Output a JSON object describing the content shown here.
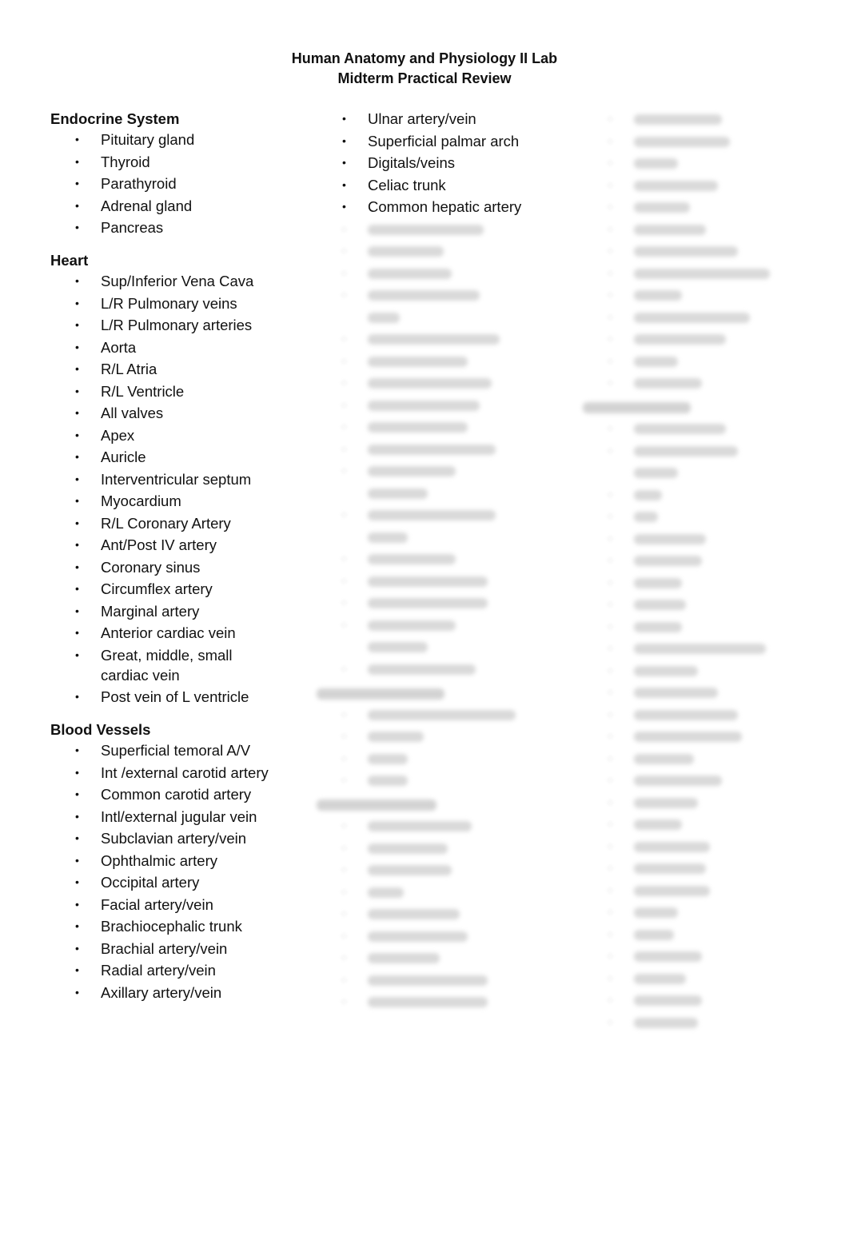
{
  "document": {
    "title_line_1": "Human Anatomy and Physiology II Lab",
    "title_line_2": "Midterm Practical Review"
  },
  "bullet_glyph": "•",
  "column_1": {
    "sections": [
      {
        "heading": "Endocrine System",
        "items": [
          "Pituitary gland",
          "Thyroid",
          "Parathyroid",
          "Adrenal gland",
          "Pancreas"
        ]
      },
      {
        "heading": "Heart",
        "items": [
          "Sup/Inferior Vena Cava",
          "L/R Pulmonary veins",
          "L/R Pulmonary arteries",
          "Aorta",
          "R/L Atria",
          "R/L Ventricle",
          "All valves",
          "Apex",
          "Auricle",
          "Interventricular septum",
          "Myocardium",
          "R/L Coronary Artery",
          "Ant/Post IV artery",
          "Coronary sinus",
          "Circumflex artery",
          "Marginal artery",
          "Anterior cardiac vein",
          "Great, middle, small cardiac vein",
          "Post vein of L ventricle"
        ]
      },
      {
        "heading": "Blood Vessels",
        "items": [
          "Superficial temoral A/V",
          "Int /external carotid artery",
          "Common carotid artery",
          "Intl/external jugular vein",
          "Subclavian artery/vein",
          "Ophthalmic artery",
          "Occipital artery",
          "Facial artery/vein",
          "Brachiocephalic trunk",
          "Brachial artery/vein",
          "Radial artery/vein",
          "Axillary artery/vein"
        ]
      }
    ]
  },
  "column_2": {
    "visible_items": [
      "Ulnar artery/vein",
      "Superficial palmar arch",
      "Digitals/veins",
      "Celiac trunk",
      "Common hepatic artery"
    ],
    "obscured_note": "Remaining content in this column is blurred and unreadable"
  },
  "column_3": {
    "obscured_note": "Content in this column is blurred and unreadable"
  }
}
